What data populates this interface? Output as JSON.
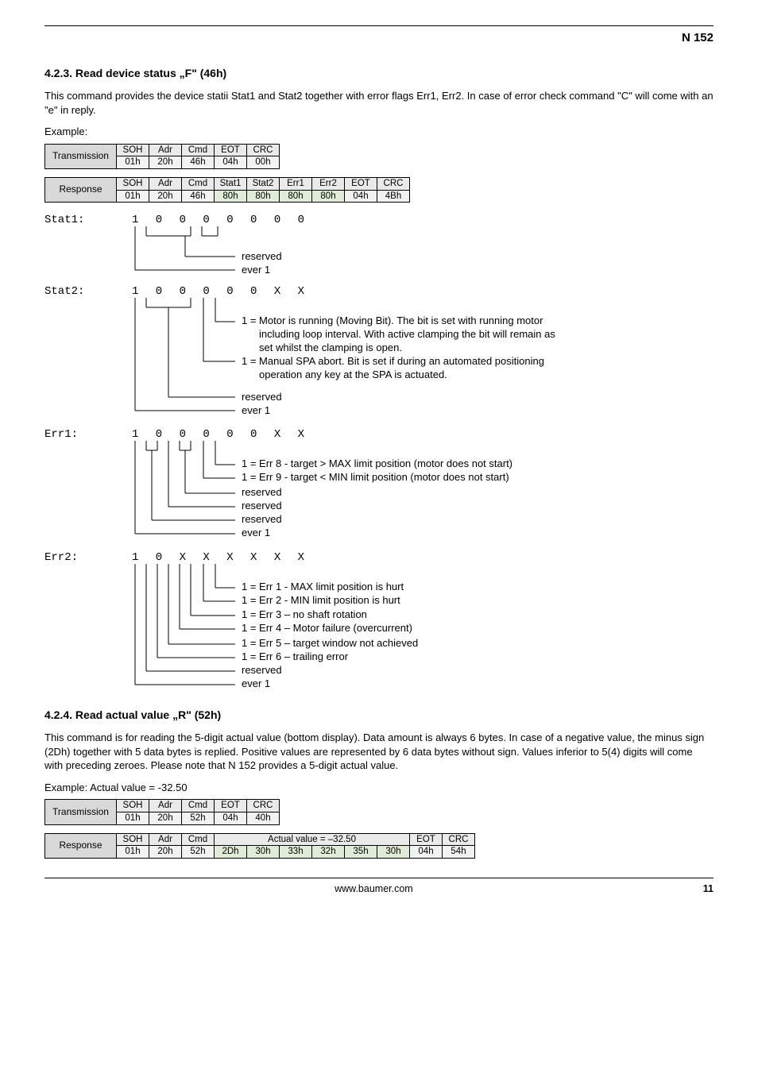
{
  "header": {
    "code": "N 152"
  },
  "sec1": {
    "num": "4.2.3.",
    "title": "Read device status „F\" (46h)",
    "para": "This command provides the device statii Stat1 and Stat2 together with error flags Err1, Err2. In case of error check command \"C\" will come with an \"e\" in reply.",
    "example": "Example:"
  },
  "tx1": {
    "label": "Transmission",
    "h": [
      "SOH",
      "Adr",
      "Cmd",
      "EOT",
      "CRC"
    ],
    "v": [
      "01h",
      "20h",
      "46h",
      "04h",
      "00h"
    ]
  },
  "rx1": {
    "label": "Response",
    "h": [
      "SOH",
      "Adr",
      "Cmd",
      "Stat1",
      "Stat2",
      "Err1",
      "Err2",
      "EOT",
      "CRC"
    ],
    "v": [
      "01h",
      "20h",
      "46h",
      "80h",
      "80h",
      "80h",
      "80h",
      "04h",
      "4Bh"
    ]
  },
  "stat1": {
    "name": "Stat1:",
    "bits": "1 0 0 0 0 0 0 0",
    "l1": "reserved",
    "l2": "ever 1"
  },
  "stat2": {
    "name": "Stat2:",
    "bits": "1 0 0 0 0 0 X X",
    "l1a": "1 = Motor is running (Moving Bit). The bit is set with running motor",
    "l1b": "including loop interval. With active clamping the bit will remain as",
    "l1c": "set whilst the clamping is open.",
    "l2a": "1 = Manual SPA abort. Bit is set if during an automated positioning",
    "l2b": "operation any key at the SPA is actuated.",
    "l3": "reserved",
    "l4": "ever 1"
  },
  "err1": {
    "name": "Err1:",
    "bits": "1 0 0 0 0 0 X X",
    "l1": "1 = Err 8 - target > MAX limit position (motor does not start)",
    "l2": "1 = Err 9 - target < MIN  limit position (motor does not start)",
    "l3": "reserved",
    "l4": "reserved",
    "l5": "reserved",
    "l6": "ever 1"
  },
  "err2": {
    "name": "Err2:",
    "bits": "1 0 X X X X X X",
    "l1": "1 = Err 1 - MAX limit position is hurt",
    "l2": "1 = Err 2 - MIN limit  position is hurt",
    "l3": "1 = Err 3 – no shaft rotation",
    "l4": "1 = Err 4 – Motor failure (overcurrent)",
    "l5": "1 = Err 5 – target window not achieved",
    "l6": "1 = Err 6 – trailing error",
    "l7": "reserved",
    "l8": "ever 1"
  },
  "sec2": {
    "num": "4.2.4.",
    "title": "Read actual value „R\" (52h)",
    "para": "This command is for reading the 5-digit actual value (bottom display). Data amount is always 6 bytes. In case of a negative value, the minus sign (2Dh) together with 5 data bytes is replied. Positive values are represented by 6 data bytes without sign. Values inferior to 5(4) digits will come with preceding zeroes. Please note that N 152 provides a 5-digit actual value.",
    "example": "Example: Actual value = -32.50"
  },
  "tx2": {
    "label": "Transmission",
    "h": [
      "SOH",
      "Adr",
      "Cmd",
      "EOT",
      "CRC"
    ],
    "v": [
      "01h",
      "20h",
      "52h",
      "04h",
      "40h"
    ]
  },
  "rx2": {
    "label": "Response",
    "h": [
      "SOH",
      "Adr",
      "Cmd",
      "Actual value = –32.50",
      "EOT",
      "CRC"
    ],
    "v": [
      "01h",
      "20h",
      "52h",
      "2Dh",
      "30h",
      "33h",
      "32h",
      "35h",
      "30h",
      "04h",
      "54h"
    ]
  },
  "footer": {
    "url": "www.baumer.com",
    "page": "11"
  }
}
